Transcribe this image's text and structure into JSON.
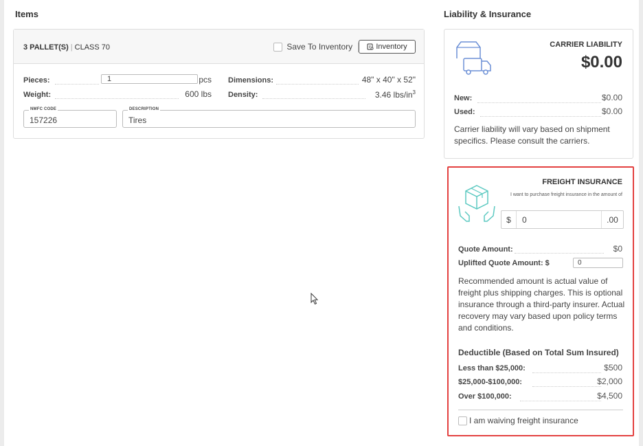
{
  "items": {
    "section_title": "Items",
    "pallets": "3 PALLET(S)",
    "separator": "|",
    "class": "CLASS 70",
    "save_to_inventory": "Save To Inventory",
    "inventory_button": "Inventory",
    "pieces_label": "Pieces:",
    "pieces_value": "1",
    "pieces_unit": "pcs",
    "weight_label": "Weight:",
    "weight_value": "600 lbs",
    "dimensions_label": "Dimensions:",
    "dimensions_value": "48\" x 40\" x 52\"",
    "density_label": "Density:",
    "density_value": "3.46 lbs/in",
    "density_exp": "3",
    "nmfc_label": "NMFC CODE",
    "nmfc_value": "157226",
    "description_label": "DESCRIPTION",
    "description_value": "Tires"
  },
  "liability": {
    "section_title": "Liability & Insurance",
    "card_title": "CARRIER LIABILITY",
    "amount": "$0.00",
    "new_label": "New:",
    "new_value": "$0.00",
    "used_label": "Used:",
    "used_value": "$0.00",
    "note": "Carrier liability will vary based on shipment specifics. Please consult the carriers."
  },
  "insurance": {
    "card_title": "FREIGHT INSURANCE",
    "subtitle": "I want to purchase freight insurance in the amount of",
    "currency_prefix": "$",
    "amount_value": "0",
    "amount_suffix": ".00",
    "quote_label": "Quote Amount:",
    "quote_value": "$0",
    "uplifted_label": "Uplifted Quote Amount: $",
    "uplifted_value": "0",
    "note": "Recommended amount is actual value of freight plus shipping charges. This is optional insurance through a third-party insurer. Actual recovery may vary based upon policy terms and conditions.",
    "deductible_title": "Deductible (Based on Total Sum Insured)",
    "deductibles": [
      {
        "label": "Less than $25,000:",
        "value": "$500"
      },
      {
        "label": "$25,000-$100,000:",
        "value": "$2,000"
      },
      {
        "label": "Over $100,000:",
        "value": "$4,500"
      }
    ],
    "waive_label": "I am waiving freight insurance"
  },
  "colors": {
    "highlight_border": "#e3403f",
    "truck_icon": "#6b8fd6",
    "insurance_icon": "#5cc9c1"
  },
  "icons": [
    "truck-icon",
    "box-hands-icon",
    "inventory-icon",
    "mouse-cursor-icon"
  ]
}
